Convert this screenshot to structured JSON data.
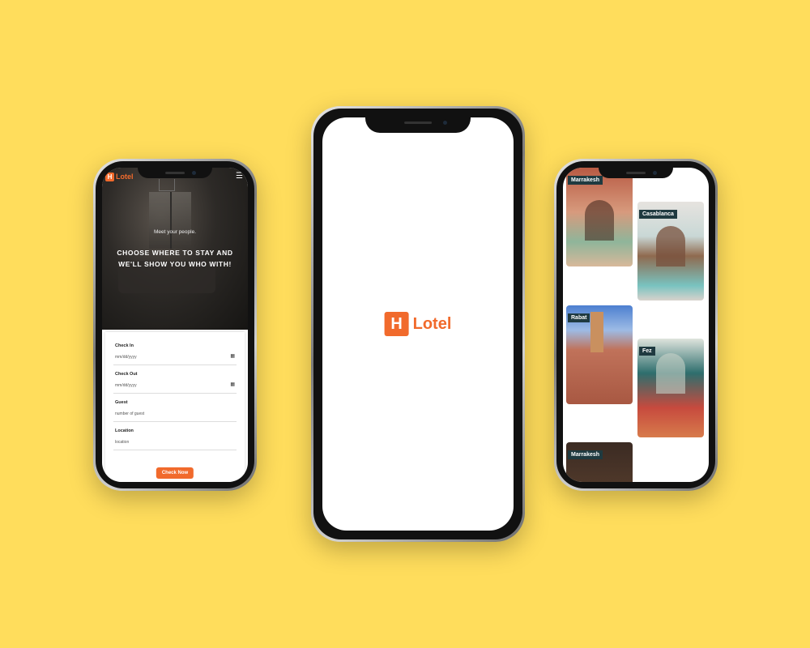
{
  "brand": {
    "name": "Lotel",
    "mark": "H",
    "accent": "#F16A2C",
    "background": "#FFDD5C"
  },
  "home": {
    "menu_icon": "☰",
    "hero_subtitle": "Meet your people.",
    "hero_title": "CHOOSE WHERE TO STAY AND WE'LL SHOW YOU WHO WITH!",
    "fields": [
      {
        "label": "Check In",
        "placeholder": "mm/dd/yyyy",
        "icon": "calendar-icon"
      },
      {
        "label": "Check Out",
        "placeholder": "mm/dd/yyyy",
        "icon": "calendar-icon"
      },
      {
        "label": "Guest",
        "placeholder": "number of guest"
      },
      {
        "label": "Location",
        "placeholder": "location"
      }
    ],
    "submit_label": "Check Now"
  },
  "splash": {
    "logo_text": "Lotel"
  },
  "cities": {
    "items": [
      {
        "name": "Marrakesh"
      },
      {
        "name": "Casablanca"
      },
      {
        "name": "Rabat"
      },
      {
        "name": "Fez"
      },
      {
        "name": "Marrakesh"
      }
    ]
  }
}
